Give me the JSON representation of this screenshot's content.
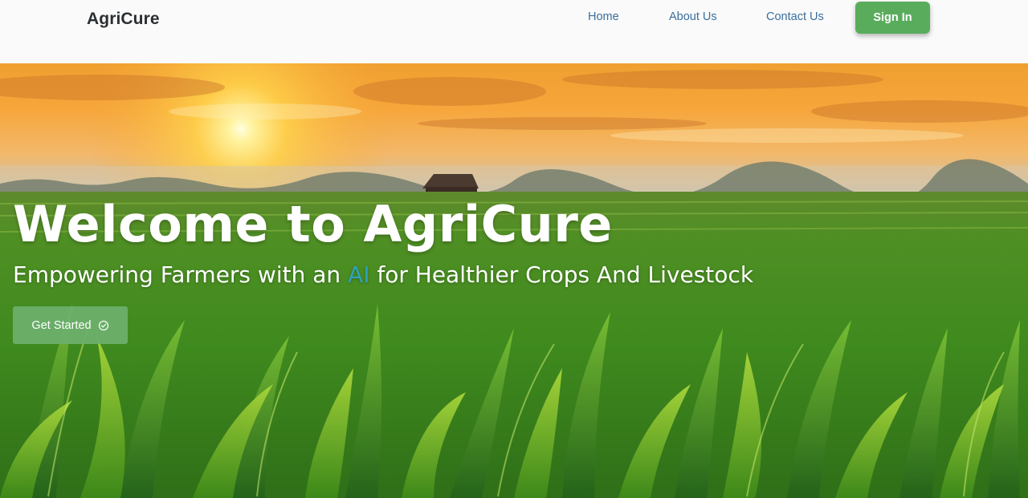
{
  "header": {
    "brand": "AgriCure",
    "nav": {
      "home": "Home",
      "about": "About Us",
      "contact": "Contact Us"
    },
    "signin_label": "Sign In"
  },
  "hero": {
    "title": "Welcome to AgriCure",
    "subtitle_before": "Empowering Farmers with an ",
    "subtitle_highlight": "AI",
    "subtitle_after": " for Healthier Crops And Livestock",
    "cta_label": "Get Started",
    "cta_icon": "check-circle-icon",
    "background": "sunset-cornfield-image"
  },
  "colors": {
    "accent_green": "#5aac5d",
    "nav_link": "#3a6e9e",
    "ai_highlight": "#2fa3b8"
  }
}
